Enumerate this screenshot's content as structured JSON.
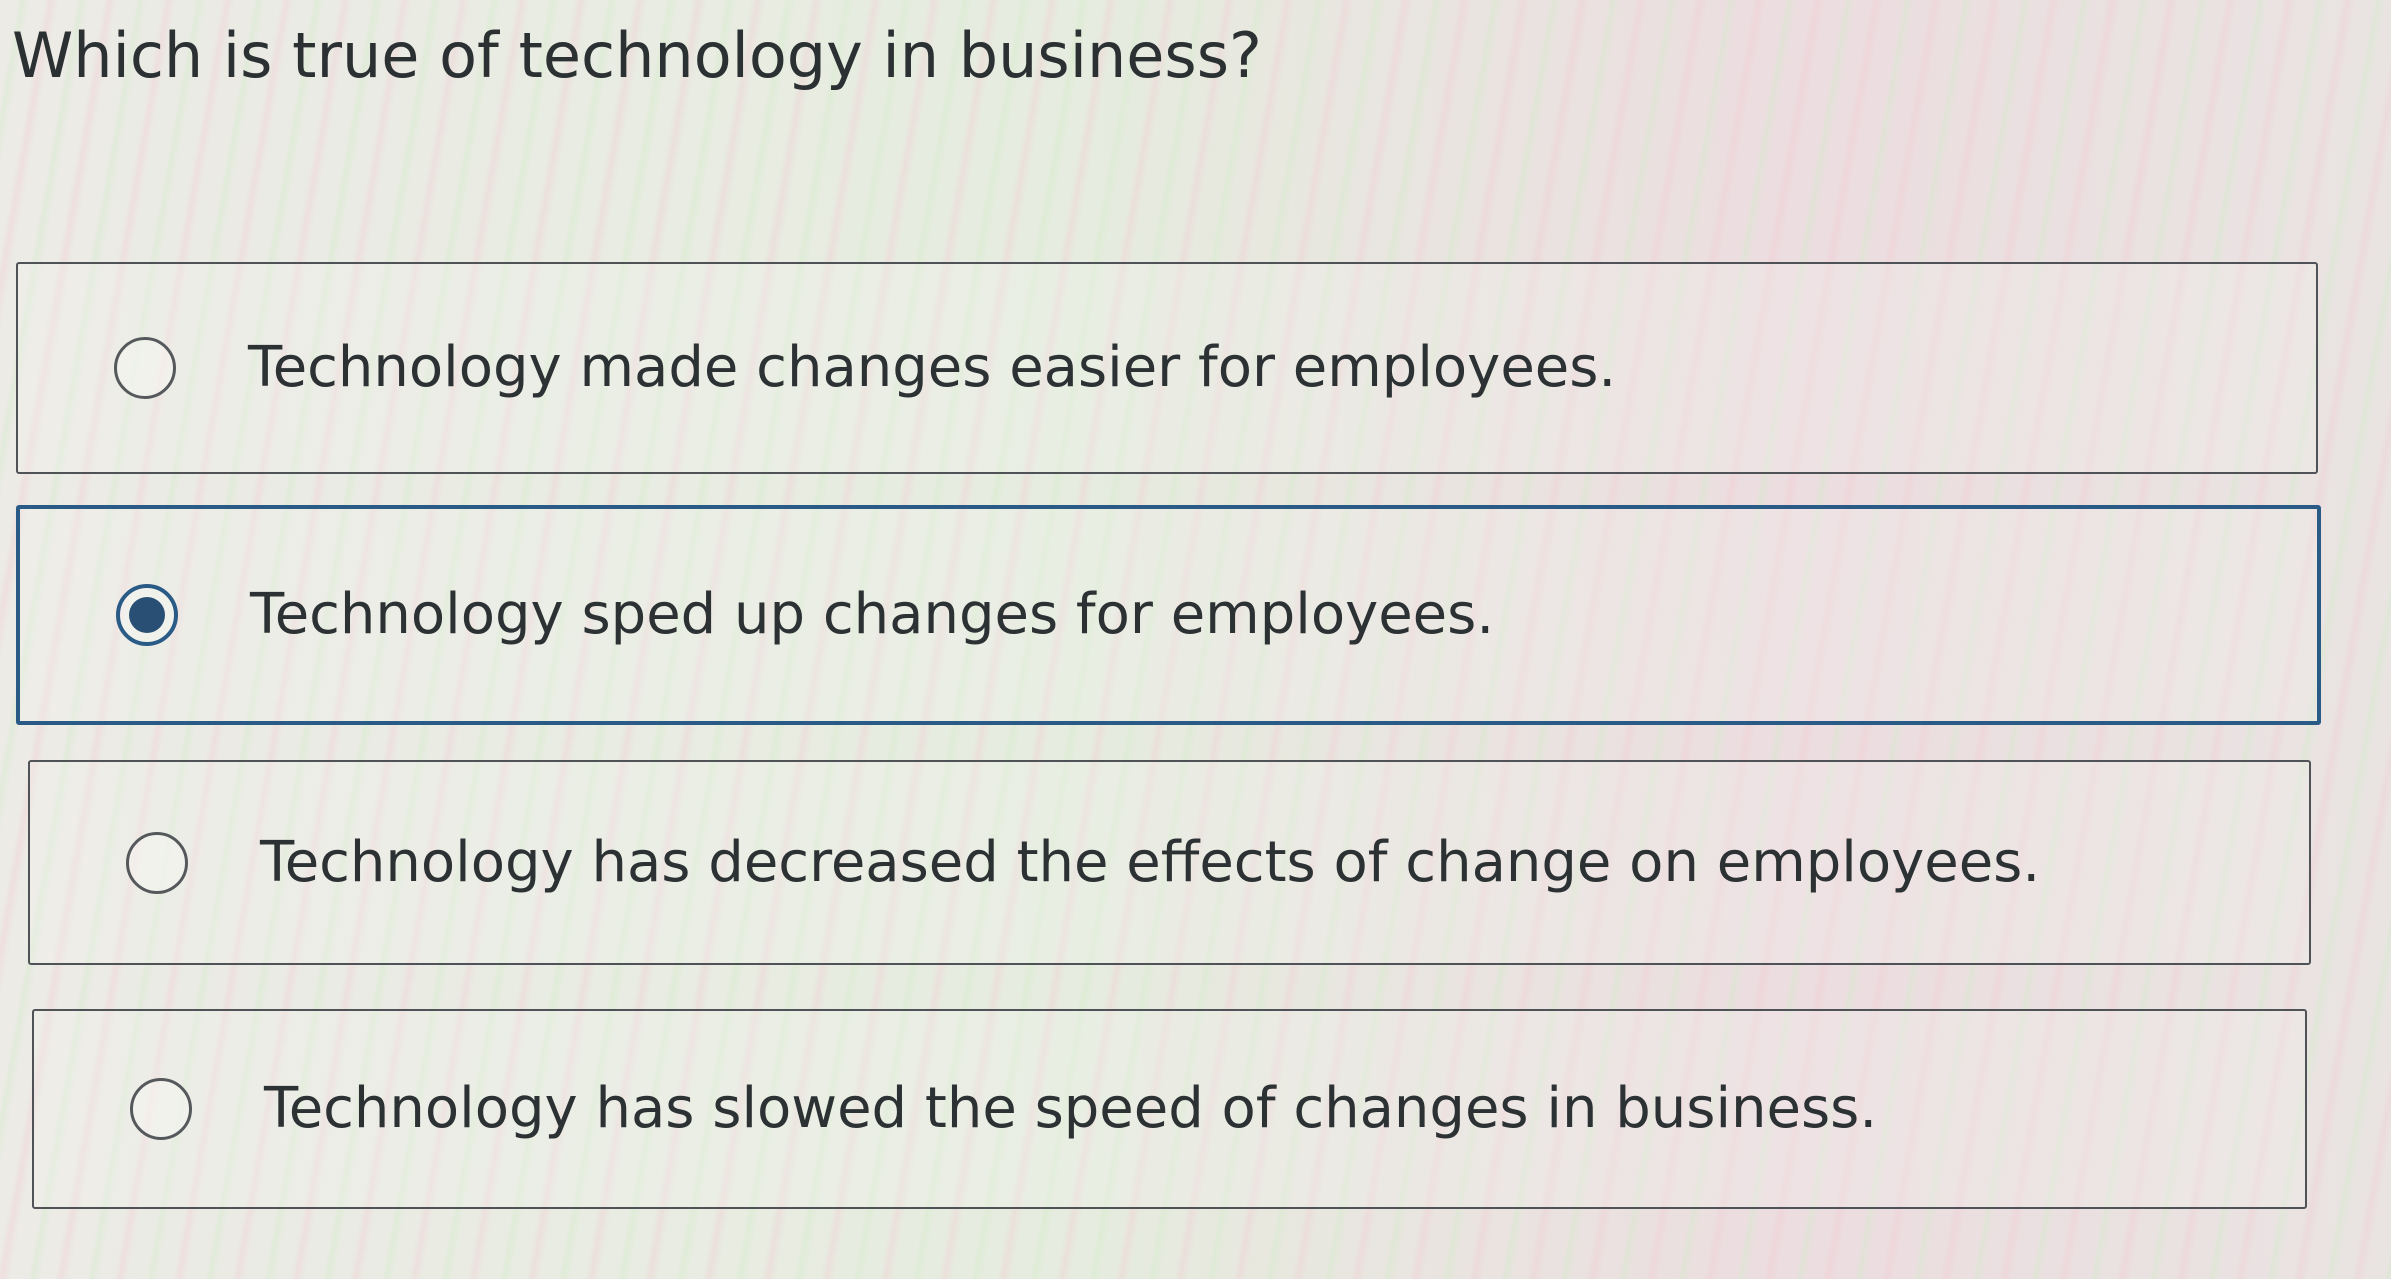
{
  "question": {
    "text": "Which is true of technology in business?"
  },
  "options": [
    {
      "label": "Technology made changes easier for employees.",
      "selected": false
    },
    {
      "label": "Technology sped up changes for employees.",
      "selected": true
    },
    {
      "label": "Technology has decreased the effects of change on employees.",
      "selected": false
    },
    {
      "label": "Technology has slowed the speed of changes in business.",
      "selected": false
    }
  ],
  "colors": {
    "selected_accent": "#2a5a86",
    "border_default": "#4f5357",
    "text": "#2c3134"
  },
  "icons": {
    "radio_unselected": "radio-empty-icon",
    "radio_selected": "radio-filled-icon"
  }
}
